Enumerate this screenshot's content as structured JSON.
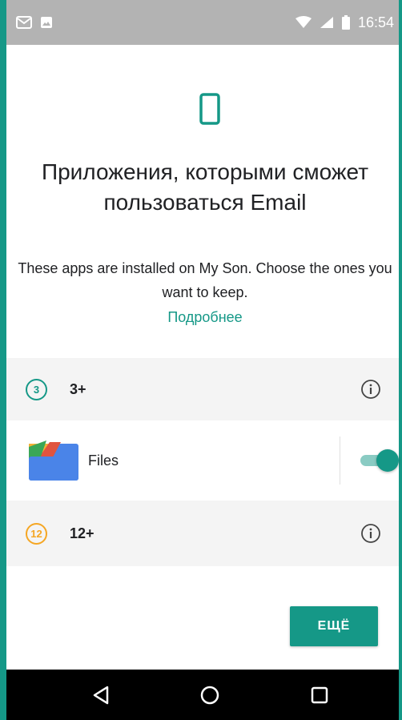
{
  "status_bar": {
    "time": "16:54",
    "left_icons": [
      "gmail-notification-icon",
      "image-notification-icon"
    ],
    "right_icons": [
      "wifi-icon",
      "cellular-signal-icon",
      "battery-icon"
    ]
  },
  "header": {
    "icon": "phone-device-icon",
    "title": "Приложения, которыми сможет пользоваться Email",
    "description": "These apps are installed on My Son. Choose the ones you want to keep.",
    "learn_more": "Подробнее"
  },
  "sections": [
    {
      "badge": "3",
      "label": "3+",
      "badge_color": "#159887"
    },
    {
      "badge": "12",
      "label": "12+",
      "badge_color": "#f5a623"
    }
  ],
  "apps": [
    {
      "name": "Files",
      "enabled": true
    }
  ],
  "more_button": "ЕЩЁ",
  "nav_bar": {
    "icons": [
      "back-icon",
      "home-icon",
      "recent-apps-icon"
    ]
  },
  "colors": {
    "accent": "#159887",
    "orange": "#f5a623",
    "status_bar": "#b3b3b3",
    "nav_bar": "#000000"
  }
}
